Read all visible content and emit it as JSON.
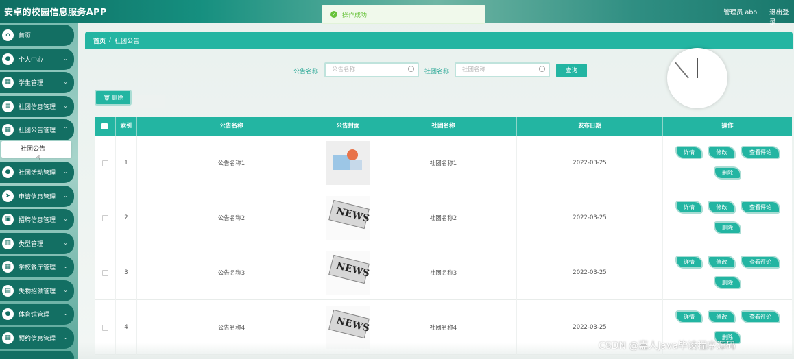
{
  "app": {
    "title": "安卓的校园信息服务APP",
    "admin": "管理员 abo",
    "logout": "退出登录"
  },
  "toast": {
    "message": "操作成功",
    "icon": "check-circle-icon"
  },
  "sidebar": {
    "items": [
      {
        "label": "首页",
        "icon": "home-icon"
      },
      {
        "label": "个人中心",
        "icon": "user-icon"
      },
      {
        "label": "学生管理",
        "icon": "grid-icon"
      },
      {
        "label": "社团信息管理",
        "icon": "list-icon"
      },
      {
        "label": "社团公告管理",
        "icon": "grid-icon"
      },
      {
        "label": "社团活动管理",
        "icon": "chat-icon"
      },
      {
        "label": "申请信息管理",
        "icon": "send-icon"
      },
      {
        "label": "招聘信息管理",
        "icon": "file-icon"
      },
      {
        "label": "类型管理",
        "icon": "book-icon"
      },
      {
        "label": "学校餐厅管理",
        "icon": "grid-icon"
      },
      {
        "label": "失物招领管理",
        "icon": "clipboard-icon"
      },
      {
        "label": "体育馆管理",
        "icon": "user-icon"
      },
      {
        "label": "预约信息管理",
        "icon": "grid-icon"
      }
    ],
    "active_sub": "社团公告"
  },
  "breadcrumb": {
    "home": "首页",
    "sep": "/",
    "current": "社团公告"
  },
  "search": {
    "label1": "公告名称",
    "placeholder1": "公告名称",
    "label2": "社团名称",
    "placeholder2": "社团名称",
    "button": "查询"
  },
  "toolbar": {
    "delete": "删除"
  },
  "table": {
    "headers": [
      "索引",
      "公告名称",
      "公告封面",
      "社团名称",
      "发布日期",
      "操作"
    ],
    "rows": [
      {
        "index": "1",
        "title": "公告名称1",
        "club": "社团名称1",
        "date": "2022-03-25"
      },
      {
        "index": "2",
        "title": "公告名称2",
        "club": "社团名称2",
        "date": "2022-03-25"
      },
      {
        "index": "3",
        "title": "公告名称3",
        "club": "社团名称3",
        "date": "2022-03-25"
      },
      {
        "index": "4",
        "title": "公告名称4",
        "club": "社团名称4",
        "date": "2022-03-25"
      }
    ],
    "actions": {
      "detail": "详情",
      "edit": "修改",
      "comments": "查看评论",
      "delete": "删除"
    }
  },
  "watermark": "CSDN @嘉人Java毕设程序源码",
  "colors": {
    "accent": "#23b5a2",
    "sidebar": "#136f63",
    "success": "#67c23a"
  }
}
